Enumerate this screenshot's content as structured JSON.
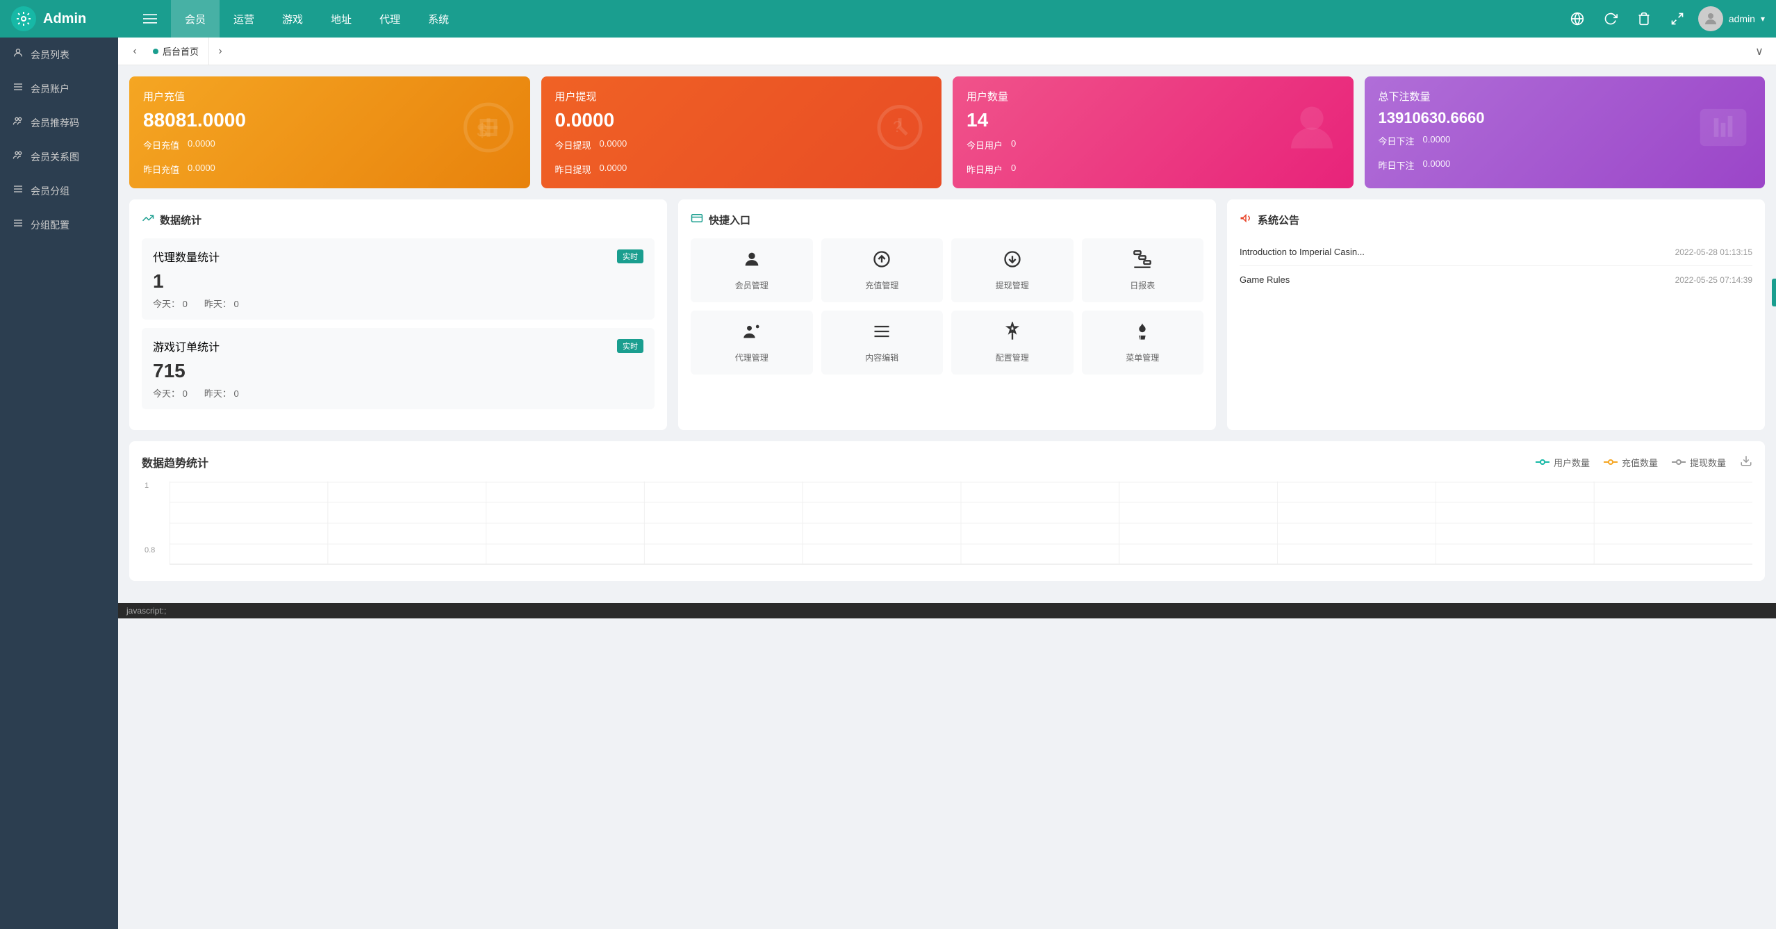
{
  "header": {
    "logo_text": "Admin",
    "nav_items": [
      {
        "label": "≡",
        "id": "menu-toggle"
      },
      {
        "label": "会员",
        "id": "member",
        "active": true
      },
      {
        "label": "运营",
        "id": "ops"
      },
      {
        "label": "游戏",
        "id": "game"
      },
      {
        "label": "地址",
        "id": "address"
      },
      {
        "label": "代理",
        "id": "proxy"
      },
      {
        "label": "系统",
        "id": "system"
      }
    ],
    "user": "admin",
    "icons": [
      "globe",
      "refresh",
      "delete",
      "expand"
    ]
  },
  "sidebar": {
    "items": [
      {
        "label": "会员列表",
        "icon": "👤"
      },
      {
        "label": "会员账户",
        "icon": "☰"
      },
      {
        "label": "会员推荐码",
        "icon": "👥"
      },
      {
        "label": "会员关系图",
        "icon": "👥"
      },
      {
        "label": "会员分组",
        "icon": "☰"
      },
      {
        "label": "分组配置",
        "icon": "☰"
      }
    ]
  },
  "tab_bar": {
    "prev_label": "‹",
    "next_label": "›",
    "expand_label": "∨",
    "tab_label": "后台首页"
  },
  "stat_cards": [
    {
      "id": "recharge",
      "title": "用户充值",
      "value": "88081.0000",
      "sub1_label": "今日充值",
      "sub1_value": "0.0000",
      "sub2_label": "昨日充值",
      "sub2_value": "0.0000",
      "color": "orange",
      "icon": "$"
    },
    {
      "id": "withdraw",
      "title": "用户提现",
      "value": "0.0000",
      "sub1_label": "今日提现",
      "sub1_value": "0.0000",
      "sub2_label": "昨日提现",
      "sub2_value": "0.0000",
      "color": "red",
      "icon": "?"
    },
    {
      "id": "users",
      "title": "用户数量",
      "value": "14",
      "sub1_label": "今日用户",
      "sub1_value": "0",
      "sub2_label": "昨日用户",
      "sub2_value": "0",
      "color": "pink",
      "icon": "👤"
    },
    {
      "id": "total_bets",
      "title": "总下注数量",
      "value": "13910630.6660",
      "sub1_label": "今日下注",
      "sub1_value": "0.0000",
      "sub2_label": "昨日下注",
      "sub2_value": "0.0000",
      "color": "purple",
      "icon": "📖"
    }
  ],
  "data_stats": {
    "title": "数据统计",
    "agent_block": {
      "label": "代理数量统计",
      "badge": "实时",
      "value": "1",
      "today_label": "今天：",
      "today_value": "0",
      "yesterday_label": "昨天：",
      "yesterday_value": "0"
    },
    "game_block": {
      "label": "游戏订单统计",
      "badge": "实时",
      "value": "715",
      "today_label": "今天：",
      "today_value": "0",
      "yesterday_label": "昨天：",
      "yesterday_value": "0"
    }
  },
  "quick_access": {
    "title": "快捷入口",
    "items": [
      {
        "label": "会员管理",
        "icon": "👤"
      },
      {
        "label": "充值管理",
        "icon": "⊕"
      },
      {
        "label": "提现管理",
        "icon": "⊙"
      },
      {
        "label": "日报表",
        "icon": "📊"
      },
      {
        "label": "代理管理",
        "icon": "👤+"
      },
      {
        "label": "内容编辑",
        "icon": "☰"
      },
      {
        "label": "配置管理",
        "icon": "✳"
      },
      {
        "label": "菜单管理",
        "icon": "🌲"
      }
    ]
  },
  "system_announcement": {
    "title": "系统公告",
    "items": [
      {
        "text": "Introduction to Imperial Casin...",
        "date": "2022-05-28 01:13:15"
      },
      {
        "text": "Game Rules",
        "date": "2022-05-25 07:14:39"
      }
    ]
  },
  "trend_chart": {
    "title": "数据趋势统计",
    "download_label": "⬇",
    "legend": [
      {
        "label": "用户数量",
        "color": "#17b8a6"
      },
      {
        "label": "充值数量",
        "color": "#f5a623"
      },
      {
        "label": "提现数量",
        "color": "#666"
      }
    ],
    "y_labels": [
      "1",
      "0.8"
    ],
    "x_labels": []
  },
  "status_bar": {
    "text": "javascript:;"
  },
  "icons": {
    "globe": "🌐",
    "refresh": "↺",
    "delete": "🗑",
    "expand": "⤢",
    "chart_trend": "📈",
    "megaphone": "📢",
    "credit_card": "💳"
  }
}
